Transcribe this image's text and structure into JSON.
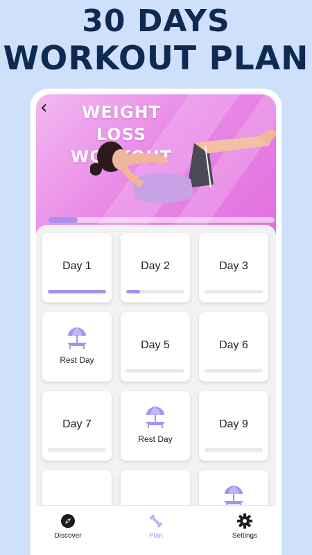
{
  "promo": {
    "line1": "30 DAYS",
    "line2": "WORKOUT PLAN"
  },
  "header": {
    "title_line1": "WEIGHT LOSS",
    "title_line2": "WORKOUT",
    "progress": 0.13
  },
  "colors": {
    "accent": "#a892f0",
    "background": "#cfe0fb",
    "headline": "#0f2a52",
    "hero": "#e98ae7"
  },
  "days": [
    {
      "label": "Day 1",
      "type": "day",
      "progress": 1.0
    },
    {
      "label": "Day 2",
      "type": "day",
      "progress": 0.24
    },
    {
      "label": "Day 3",
      "type": "day",
      "progress": 0
    },
    {
      "label": "Rest Day",
      "type": "rest",
      "icon": "beach-chair-icon"
    },
    {
      "label": "Day 5",
      "type": "day",
      "progress": 0
    },
    {
      "label": "Day 6",
      "type": "day",
      "progress": 0
    },
    {
      "label": "Day 7",
      "type": "day",
      "progress": 0
    },
    {
      "label": "Rest Day",
      "type": "rest",
      "icon": "beach-chair-icon"
    },
    {
      "label": "Day 9",
      "type": "day",
      "progress": 0
    }
  ],
  "tabs": [
    {
      "label": "Discover",
      "icon": "compass-icon",
      "active": false
    },
    {
      "label": "Plan",
      "icon": "dumbbell-icon",
      "active": true
    },
    {
      "label": "Settings",
      "icon": "gear-icon",
      "active": false
    }
  ]
}
